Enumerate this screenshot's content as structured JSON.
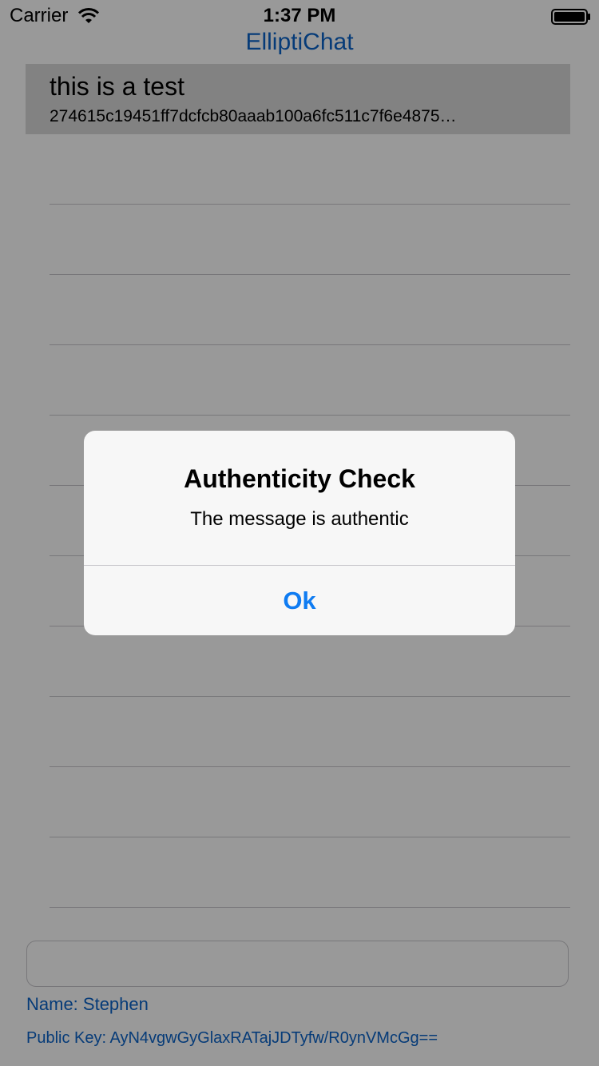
{
  "status_bar": {
    "carrier": "Carrier",
    "time": "1:37 PM",
    "wifi_icon": "wifi-icon",
    "battery_icon": "battery-icon"
  },
  "nav": {
    "title": "ElliptiChat"
  },
  "messages": [
    {
      "title": "this is a test",
      "subtitle": "274615c19451ff7dcfcb80aaab100a6fc511c7f6e4875…",
      "selected": true
    }
  ],
  "footer": {
    "input_value": "",
    "name": "Name: Stephen",
    "public_key": "Public Key: AyN4vgwGyGlaxRATajJDTyfw/R0ynVMcGg=="
  },
  "alert": {
    "title": "Authenticity Check",
    "message": "The message is authentic",
    "button_label": "Ok"
  },
  "colors": {
    "accent": "#0a63c8",
    "alert_button": "#0f7cf2",
    "selected_row": "#d9d9d9",
    "separator": "#c8c7cc"
  }
}
